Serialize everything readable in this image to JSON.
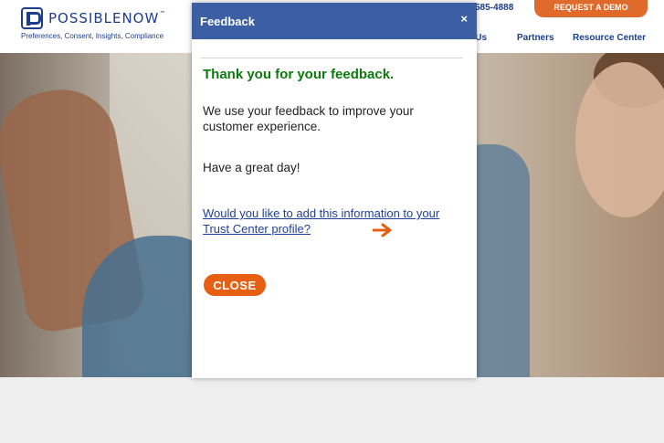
{
  "header": {
    "logo_text": "POSSIBLENOW",
    "logo_tm": "™",
    "tagline": "Preferences, Consent, Insights, Compliance",
    "phone": "585-4888",
    "cta_label": "REQUEST A DEMO",
    "nav": [
      "ut Us",
      "Partners",
      "Resource Center"
    ]
  },
  "modal": {
    "title": "Feedback",
    "close_glyph": "×",
    "heading": "Thank you for your feedback.",
    "message": "We use your feedback to improve your customer experience.",
    "greeting": "Have a great day!",
    "link_text": "Would you like to add this information to your Trust Center profile?",
    "close_label": "CLOSE"
  },
  "colors": {
    "brand_blue": "#1d3f8a",
    "modal_header": "#3c5fa3",
    "success_green": "#0d7a0d",
    "accent_orange": "#e75f12"
  },
  "icons": {
    "close": "close-icon",
    "arrow": "arrow-right-icon"
  }
}
